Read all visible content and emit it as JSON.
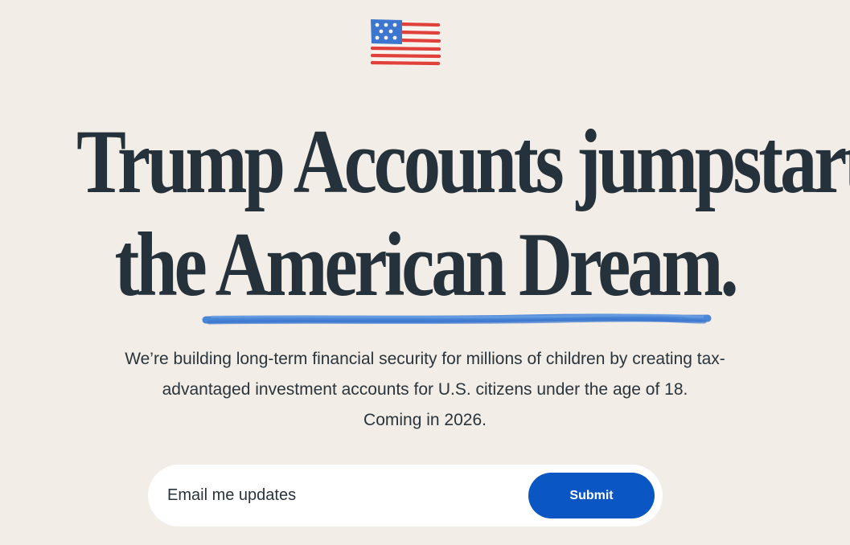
{
  "hero": {
    "flag_icon": "us-flag-icon",
    "headline_line1": "Trump Accounts jumpstart",
    "headline_line2": "the American Dream.",
    "subtext_line1": "We’re building long-term financial security for millions of children by creating tax-",
    "subtext_line2": "advantaged investment accounts for U.S. citizens under the age of 18.",
    "subtext_line3": "Coming in 2026."
  },
  "signup": {
    "email_placeholder": "Email me updates",
    "email_value": "",
    "submit_label": "Submit"
  },
  "colors": {
    "background": "#f2ede6",
    "headline": "#26323b",
    "accent_blue": "#0a56c3",
    "underline_blue": "#4a86d6",
    "flag_red": "#e0413a",
    "flag_blue": "#3c76cf"
  }
}
